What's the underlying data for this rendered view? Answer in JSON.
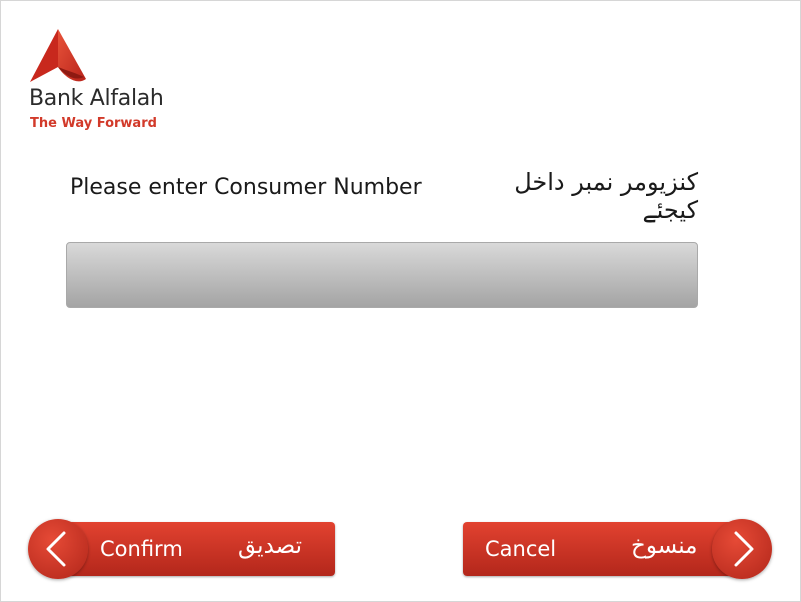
{
  "brand": {
    "name": "Bank Alfalah",
    "tagline": "The Way Forward",
    "accent_color": "#d23a2a"
  },
  "prompt": {
    "english": "Please enter Consumer Number",
    "urdu": "کنزیومر نمبر داخل کیجئے"
  },
  "consumer_number": {
    "value": ""
  },
  "buttons": {
    "confirm": {
      "label": "Confirm",
      "label_urdu": "تصدیق",
      "icon": "chevron-left-icon"
    },
    "cancel": {
      "label": "Cancel",
      "label_urdu": "منسوخ",
      "icon": "chevron-right-icon"
    }
  }
}
